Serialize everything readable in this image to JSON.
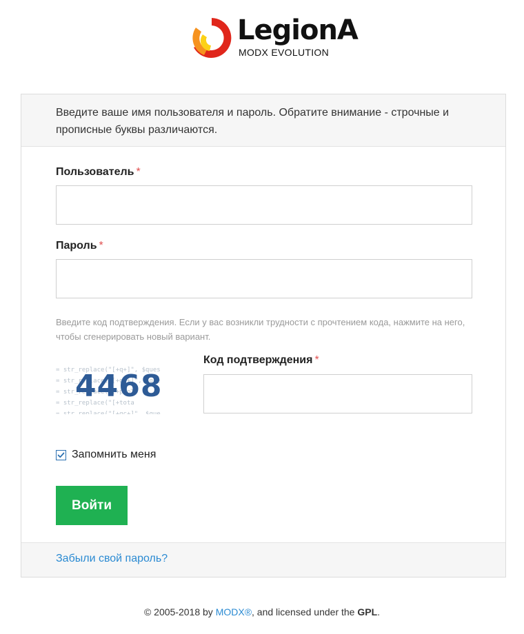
{
  "logo": {
    "title": "LegionA",
    "subtitle": "MODX EVOLUTION",
    "colors": {
      "red": "#e0261b",
      "orange": "#f6921e",
      "yellow": "#fcd116"
    }
  },
  "intro": {
    "text": "Введите ваше имя пользователя и пароль. Обратите внимание - строчные и прописные буквы различаются."
  },
  "username": {
    "label": "Пользователь",
    "required_mark": "*",
    "value": "",
    "placeholder": ""
  },
  "password": {
    "label": "Пароль",
    "required_mark": "*",
    "value": "",
    "placeholder": ""
  },
  "captcha": {
    "hint": "Введите код подтверждения. Если у вас возникли трудности с прочтением кода, нажмите на него, чтобы сгенерировать новый вариант.",
    "image_value": "4468",
    "background_lines": "= str_replace(\"[+q+]\", $ques\n= str_replace(\"[+qt+]\", $que\n= str_replace(\"[+phpT\n= str_replace(\"[+tota\n= str_replace(\"[+qc+]\", $que",
    "label": "Код подтверждения",
    "required_mark": "*",
    "value": "",
    "placeholder": ""
  },
  "remember": {
    "label": "Запомнить меня",
    "checked": true
  },
  "login_button": {
    "label": "Войти",
    "color": "#1fb152"
  },
  "forgot": {
    "label": "Забыли свой пароль?"
  },
  "footer": {
    "prefix": "© 2005-2018 by ",
    "modx_link": "MODX®",
    "middle": ", and licensed under the ",
    "gpl": "GPL",
    "suffix": "."
  },
  "colors": {
    "link": "#2a8ad2",
    "panel_bg": "#f6f6f6",
    "required": "#e05050"
  }
}
